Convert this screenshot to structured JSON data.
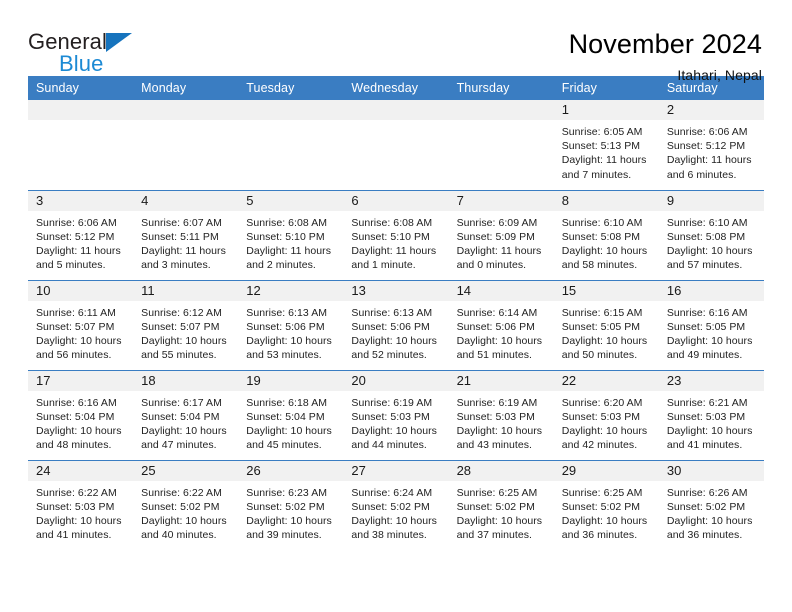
{
  "brand": {
    "name_dark": "General",
    "name_blue": "Blue",
    "color_dark": "#231f20",
    "color_blue": "#1c8ad4",
    "triangle_color": "#1673bd"
  },
  "header": {
    "title": "November 2024",
    "subtitle": "Itahari, Nepal",
    "accent_color": "#3a7dc2"
  },
  "weekdays": [
    "Sunday",
    "Monday",
    "Tuesday",
    "Wednesday",
    "Thursday",
    "Friday",
    "Saturday"
  ],
  "labels": {
    "sunrise_prefix": "Sunrise:",
    "sunset_prefix": "Sunset:",
    "daylight_prefix": "Daylight:"
  },
  "weeks": [
    [
      {
        "day": "",
        "blank": true
      },
      {
        "day": "",
        "blank": true
      },
      {
        "day": "",
        "blank": true
      },
      {
        "day": "",
        "blank": true
      },
      {
        "day": "",
        "blank": true
      },
      {
        "day": "1",
        "sunrise": "Sunrise: 6:05 AM",
        "sunset": "Sunset: 5:13 PM",
        "daylight": "Daylight: 11 hours and 7 minutes."
      },
      {
        "day": "2",
        "sunrise": "Sunrise: 6:06 AM",
        "sunset": "Sunset: 5:12 PM",
        "daylight": "Daylight: 11 hours and 6 minutes."
      }
    ],
    [
      {
        "day": "3",
        "sunrise": "Sunrise: 6:06 AM",
        "sunset": "Sunset: 5:12 PM",
        "daylight": "Daylight: 11 hours and 5 minutes."
      },
      {
        "day": "4",
        "sunrise": "Sunrise: 6:07 AM",
        "sunset": "Sunset: 5:11 PM",
        "daylight": "Daylight: 11 hours and 3 minutes."
      },
      {
        "day": "5",
        "sunrise": "Sunrise: 6:08 AM",
        "sunset": "Sunset: 5:10 PM",
        "daylight": "Daylight: 11 hours and 2 minutes."
      },
      {
        "day": "6",
        "sunrise": "Sunrise: 6:08 AM",
        "sunset": "Sunset: 5:10 PM",
        "daylight": "Daylight: 11 hours and 1 minute."
      },
      {
        "day": "7",
        "sunrise": "Sunrise: 6:09 AM",
        "sunset": "Sunset: 5:09 PM",
        "daylight": "Daylight: 11 hours and 0 minutes."
      },
      {
        "day": "8",
        "sunrise": "Sunrise: 6:10 AM",
        "sunset": "Sunset: 5:08 PM",
        "daylight": "Daylight: 10 hours and 58 minutes."
      },
      {
        "day": "9",
        "sunrise": "Sunrise: 6:10 AM",
        "sunset": "Sunset: 5:08 PM",
        "daylight": "Daylight: 10 hours and 57 minutes."
      }
    ],
    [
      {
        "day": "10",
        "sunrise": "Sunrise: 6:11 AM",
        "sunset": "Sunset: 5:07 PM",
        "daylight": "Daylight: 10 hours and 56 minutes."
      },
      {
        "day": "11",
        "sunrise": "Sunrise: 6:12 AM",
        "sunset": "Sunset: 5:07 PM",
        "daylight": "Daylight: 10 hours and 55 minutes."
      },
      {
        "day": "12",
        "sunrise": "Sunrise: 6:13 AM",
        "sunset": "Sunset: 5:06 PM",
        "daylight": "Daylight: 10 hours and 53 minutes."
      },
      {
        "day": "13",
        "sunrise": "Sunrise: 6:13 AM",
        "sunset": "Sunset: 5:06 PM",
        "daylight": "Daylight: 10 hours and 52 minutes."
      },
      {
        "day": "14",
        "sunrise": "Sunrise: 6:14 AM",
        "sunset": "Sunset: 5:06 PM",
        "daylight": "Daylight: 10 hours and 51 minutes."
      },
      {
        "day": "15",
        "sunrise": "Sunrise: 6:15 AM",
        "sunset": "Sunset: 5:05 PM",
        "daylight": "Daylight: 10 hours and 50 minutes."
      },
      {
        "day": "16",
        "sunrise": "Sunrise: 6:16 AM",
        "sunset": "Sunset: 5:05 PM",
        "daylight": "Daylight: 10 hours and 49 minutes."
      }
    ],
    [
      {
        "day": "17",
        "sunrise": "Sunrise: 6:16 AM",
        "sunset": "Sunset: 5:04 PM",
        "daylight": "Daylight: 10 hours and 48 minutes."
      },
      {
        "day": "18",
        "sunrise": "Sunrise: 6:17 AM",
        "sunset": "Sunset: 5:04 PM",
        "daylight": "Daylight: 10 hours and 47 minutes."
      },
      {
        "day": "19",
        "sunrise": "Sunrise: 6:18 AM",
        "sunset": "Sunset: 5:04 PM",
        "daylight": "Daylight: 10 hours and 45 minutes."
      },
      {
        "day": "20",
        "sunrise": "Sunrise: 6:19 AM",
        "sunset": "Sunset: 5:03 PM",
        "daylight": "Daylight: 10 hours and 44 minutes."
      },
      {
        "day": "21",
        "sunrise": "Sunrise: 6:19 AM",
        "sunset": "Sunset: 5:03 PM",
        "daylight": "Daylight: 10 hours and 43 minutes."
      },
      {
        "day": "22",
        "sunrise": "Sunrise: 6:20 AM",
        "sunset": "Sunset: 5:03 PM",
        "daylight": "Daylight: 10 hours and 42 minutes."
      },
      {
        "day": "23",
        "sunrise": "Sunrise: 6:21 AM",
        "sunset": "Sunset: 5:03 PM",
        "daylight": "Daylight: 10 hours and 41 minutes."
      }
    ],
    [
      {
        "day": "24",
        "sunrise": "Sunrise: 6:22 AM",
        "sunset": "Sunset: 5:03 PM",
        "daylight": "Daylight: 10 hours and 41 minutes."
      },
      {
        "day": "25",
        "sunrise": "Sunrise: 6:22 AM",
        "sunset": "Sunset: 5:02 PM",
        "daylight": "Daylight: 10 hours and 40 minutes."
      },
      {
        "day": "26",
        "sunrise": "Sunrise: 6:23 AM",
        "sunset": "Sunset: 5:02 PM",
        "daylight": "Daylight: 10 hours and 39 minutes."
      },
      {
        "day": "27",
        "sunrise": "Sunrise: 6:24 AM",
        "sunset": "Sunset: 5:02 PM",
        "daylight": "Daylight: 10 hours and 38 minutes."
      },
      {
        "day": "28",
        "sunrise": "Sunrise: 6:25 AM",
        "sunset": "Sunset: 5:02 PM",
        "daylight": "Daylight: 10 hours and 37 minutes."
      },
      {
        "day": "29",
        "sunrise": "Sunrise: 6:25 AM",
        "sunset": "Sunset: 5:02 PM",
        "daylight": "Daylight: 10 hours and 36 minutes."
      },
      {
        "day": "30",
        "sunrise": "Sunrise: 6:26 AM",
        "sunset": "Sunset: 5:02 PM",
        "daylight": "Daylight: 10 hours and 36 minutes."
      }
    ]
  ]
}
